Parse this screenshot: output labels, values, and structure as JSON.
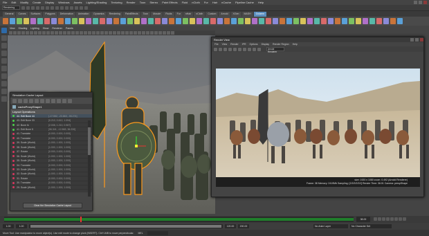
{
  "menubar": {
    "items": [
      "File",
      "Edit",
      "Modify",
      "Create",
      "Display",
      "Windows",
      "Assets",
      "Lighting/Shading",
      "Texturing",
      "Render",
      "Toon",
      "Stereo",
      "Paint Effects",
      "Fluid",
      "nCloth",
      "Fur",
      "Hair",
      "nCache",
      "Pipeline Cache",
      "Help"
    ]
  },
  "status": {
    "mode": "Rendering"
  },
  "shelf": {
    "tabs": [
      "General",
      "Curves",
      "Surfaces",
      "Polygons",
      "Deformation",
      "Animation",
      "Dynamics",
      "Rendering",
      "PaintEffects",
      "Toon",
      "Muscle",
      "Fluids",
      "Fur",
      "nHair",
      "nCloth",
      "Custom",
      "Arnold",
      "XGen",
      "MASH",
      "Golaem"
    ],
    "active_tab": "Golaem"
  },
  "viewport": {
    "menu": [
      "View",
      "Shading",
      "Lighting",
      "Show",
      "Renderer",
      "Panels"
    ]
  },
  "cache_layout": {
    "title": "Simulation Cache Layout",
    "node_name": "cacheProxyShape1",
    "section_label": "Layout Operations",
    "rows": [
      {
        "label": "44. Edit Bone 44",
        "value": "[-17.552, -23.863, -95.274]",
        "state": "green"
      },
      {
        "label": "43. Edit Bone 33",
        "value": "[0.210, 0.612, 1.094]",
        "state": "green"
      },
      {
        "label": "42. Bone Ik",
        "value": "[2.008, 1.210, 0.987]",
        "state": "green"
      },
      {
        "label": "41. Edit Bone 5",
        "value": "[96.341, -12.863, 36.230]",
        "state": "green"
      },
      {
        "label": "41. Translate",
        "value": "[0.000, 0.000, 0.000]",
        "state": "red"
      },
      {
        "label": "40. Translate",
        "value": "[0.000, 0.000, 0.000]",
        "state": "red"
      },
      {
        "label": "39. Scale (World)",
        "value": "[1.000, 1.000, 1.000]",
        "state": "red"
      },
      {
        "label": "38. Scale (World)",
        "value": "[1.000, 1.000, 1.000]",
        "state": "red"
      },
      {
        "label": "37. Rotate",
        "value": "[0.000, 0.000, 0.000]",
        "state": "red"
      },
      {
        "label": "36. Scale (World)",
        "value": "[1.000, 1.000, 1.000]",
        "state": "red"
      },
      {
        "label": "35. Scale (World)",
        "value": "[1.000, 1.000, 1.000]",
        "state": "red"
      },
      {
        "label": "34. Translate",
        "value": "[0.000, 0.000, 0.000]",
        "state": "red"
      },
      {
        "label": "33. Scale (World)",
        "value": "[1.000, 1.000, 1.000]",
        "state": "red"
      },
      {
        "label": "32. Scale (World)",
        "value": "[1.000, 1.000, 1.000]",
        "state": "red"
      },
      {
        "label": "31. Rotate",
        "value": "[0.000, 0.000, 0.000]",
        "state": "red"
      },
      {
        "label": "30. Translate",
        "value": "[0.000, 0.000, 0.000]",
        "state": "red"
      },
      {
        "label": "29. Scale (World)",
        "value": "[1.000, 1.000, 1.000]",
        "state": "red"
      }
    ],
    "clear_button": "Clear the Simulation Cache Layout"
  },
  "render_view": {
    "title": "Render View",
    "menu": [
      "File",
      "View",
      "Render",
      "IPR",
      "Options",
      "Display",
      "Render Region",
      "Help"
    ],
    "renderer": "Arnold Renderer",
    "info_line1": "size: 1920 x 1080  zoom: 0.492        (Arnold Renderer)",
    "info_line2": "Frame: 38   Memory: 2419Mb   Sampling: [2/2/2/2/2/2]   Render Time: 36:01   Camera: perspShape"
  },
  "range": {
    "start": "1.00",
    "end": "120.00",
    "anim_end": "200.00",
    "current": "38.00",
    "anim_layer": "No Anim Layer",
    "char_set": "No Character Set"
  },
  "helpline": {
    "text": "Move Tool: Use manipulator to move object(s). Use edit mode to change pivot (INSERT). Ctrl+LMB to move perpendicular.",
    "mel": "MEL"
  },
  "colors": {
    "accent": "#5b8fbf",
    "selection": "#ff9a1c",
    "grass": "#1c7f2a"
  }
}
